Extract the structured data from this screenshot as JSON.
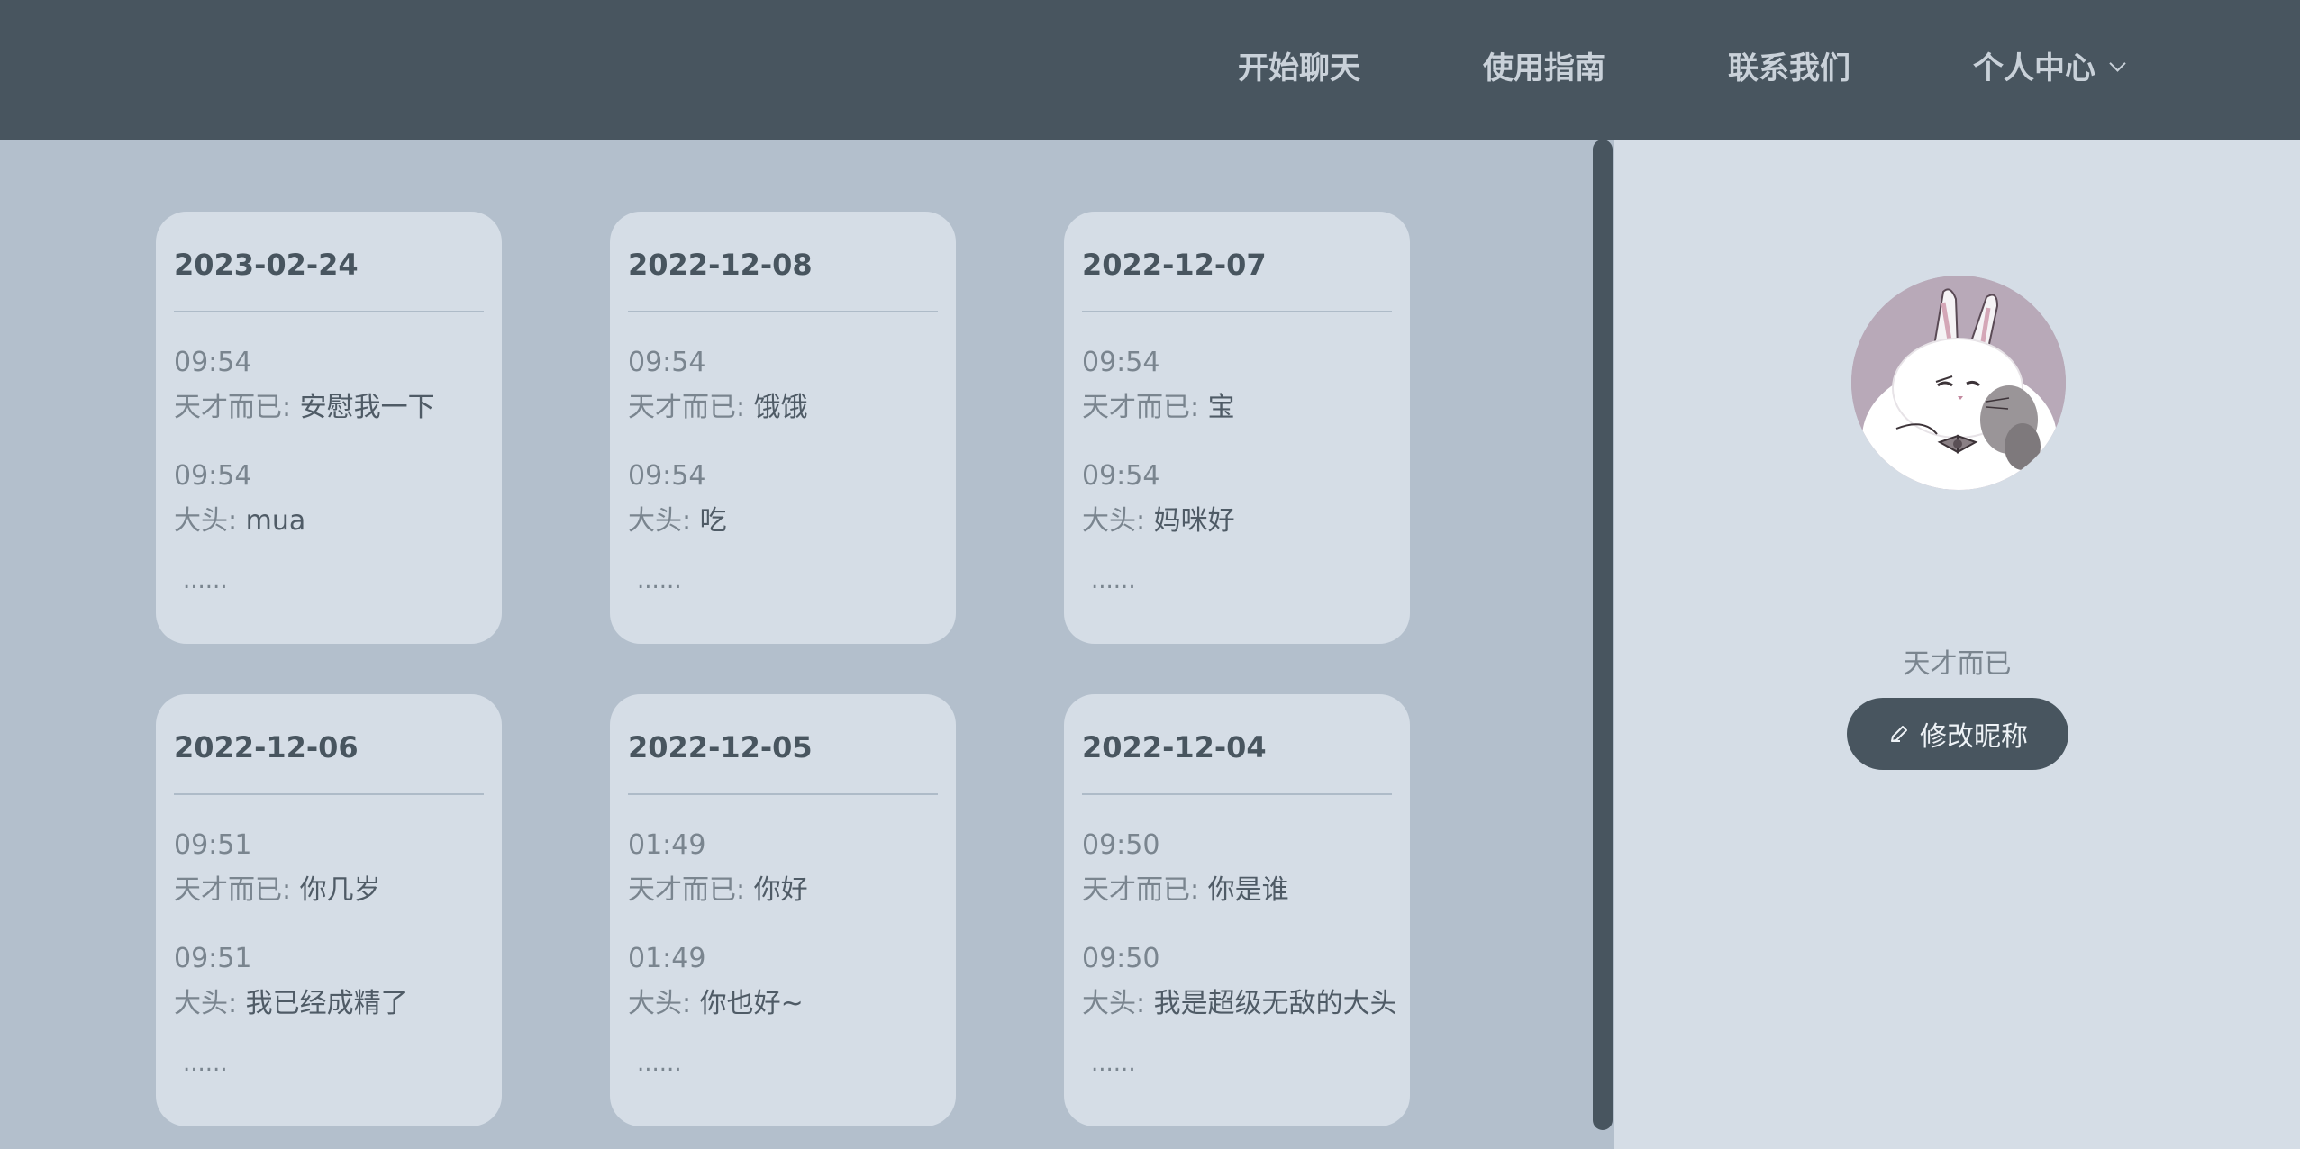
{
  "nav": {
    "items": [
      {
        "label": "开始聊天"
      },
      {
        "label": "使用指南"
      },
      {
        "label": "联系我们"
      },
      {
        "label": "个人中心"
      }
    ]
  },
  "cards": [
    {
      "date": "2023-02-24",
      "messages": [
        {
          "time": "09:54",
          "sender": "天才而已",
          "text": "安慰我一下"
        },
        {
          "time": "09:54",
          "sender": "大头",
          "text": "mua"
        }
      ],
      "more": "......"
    },
    {
      "date": "2022-12-08",
      "messages": [
        {
          "time": "09:54",
          "sender": "天才而已",
          "text": "饿饿"
        },
        {
          "time": "09:54",
          "sender": "大头",
          "text": "吃"
        }
      ],
      "more": "......"
    },
    {
      "date": "2022-12-07",
      "messages": [
        {
          "time": "09:54",
          "sender": "天才而已",
          "text": "宝"
        },
        {
          "time": "09:54",
          "sender": "大头",
          "text": "妈咪好"
        }
      ],
      "more": "......"
    },
    {
      "date": "2022-12-06",
      "messages": [
        {
          "time": "09:51",
          "sender": "天才而已",
          "text": "你几岁"
        },
        {
          "time": "09:51",
          "sender": "大头",
          "text": "我已经成精了"
        }
      ],
      "more": "......"
    },
    {
      "date": "2022-12-05",
      "messages": [
        {
          "time": "01:49",
          "sender": "天才而已",
          "text": "你好"
        },
        {
          "time": "01:49",
          "sender": "大头",
          "text": "你也好~"
        }
      ],
      "more": "......"
    },
    {
      "date": "2022-12-04",
      "messages": [
        {
          "time": "09:50",
          "sender": "天才而已",
          "text": "你是谁"
        },
        {
          "time": "09:50",
          "sender": "大头",
          "text": "我是超级无敌的大头"
        }
      ],
      "more": "......"
    }
  ],
  "profile": {
    "username": "天才而已",
    "edit_label": "修改昵称",
    "avatar_icon": "rabbit-avatar-icon"
  },
  "colors": {
    "nav_bg": "#48555f",
    "main_bg": "#b3bfcc",
    "card_bg": "#d5dde6",
    "accent": "#48555f"
  }
}
